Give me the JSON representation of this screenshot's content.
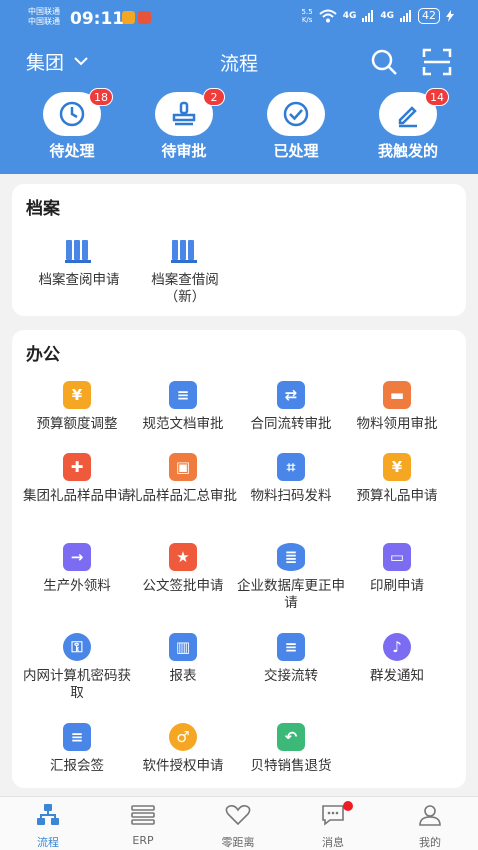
{
  "status": {
    "carrier1": "中国联通",
    "carrier2": "中国联通",
    "time": "09:11",
    "netspeed_top": "5.5",
    "netspeed_bottom": "K/s",
    "sig1": "4G",
    "sig2": "4G",
    "battery": "42"
  },
  "nav": {
    "group": "集团",
    "title": "流程"
  },
  "quick": [
    {
      "label": "待处理",
      "badge": "18"
    },
    {
      "label": "待审批",
      "badge": "2"
    },
    {
      "label": "已处理",
      "badge": ""
    },
    {
      "label": "我触发的",
      "badge": "14"
    }
  ],
  "archive": {
    "title": "档案",
    "items": [
      {
        "label": "档案查阅申请",
        "icon": "books-icon"
      },
      {
        "label": "档案查借阅（新）",
        "icon": "books-icon"
      }
    ]
  },
  "office": {
    "title": "办公",
    "items": [
      {
        "label": "预算额度调整",
        "icon": "budget-icon",
        "color": "#f5a623"
      },
      {
        "label": "规范文档审批",
        "icon": "document-icon",
        "color": "#4a86e8"
      },
      {
        "label": "合同流转审批",
        "icon": "contract-icon",
        "color": "#4a86e8"
      },
      {
        "label": "物料领用审批",
        "icon": "box-icon",
        "color": "#f07b3f"
      },
      {
        "label": "集团礼品样品申请",
        "icon": "gift-card-icon",
        "color": "#ee5a3b"
      },
      {
        "label": "礼品样品汇总审批",
        "icon": "gift-summary-icon",
        "color": "#f07b3f"
      },
      {
        "label": "物料扫码发料",
        "icon": "scan-icon",
        "color": "#4a86e8"
      },
      {
        "label": "预算礼品申请",
        "icon": "gift-icon",
        "color": "#f5a623"
      },
      {
        "label": "生产外领料",
        "icon": "inbox-icon",
        "color": "#7b6cf2"
      },
      {
        "label": "公文签批申请",
        "icon": "stamp-doc-icon",
        "color": "#ee5a3b"
      },
      {
        "label": "企业数据库更正申请",
        "icon": "database-icon",
        "color": "#4a86e8"
      },
      {
        "label": "印刷申请",
        "icon": "printer-icon",
        "color": "#7b6cf2"
      },
      {
        "label": "内网计算机密码获取",
        "icon": "key-icon",
        "color": "#4a86e8"
      },
      {
        "label": "报表",
        "icon": "report-icon",
        "color": "#4a86e8"
      },
      {
        "label": "交接流转",
        "icon": "handover-icon",
        "color": "#4a86e8"
      },
      {
        "label": "群发通知",
        "icon": "bell-icon",
        "color": "#7b6cf2"
      },
      {
        "label": "汇报会签",
        "icon": "report-sign-icon",
        "color": "#4a86e8"
      },
      {
        "label": "软件授权申请",
        "icon": "shield-icon",
        "color": "#f5a623"
      },
      {
        "label": "贝特销售退货",
        "icon": "return-icon",
        "color": "#3cb878"
      }
    ]
  },
  "tabs": [
    {
      "label": "流程",
      "icon": "flow-icon",
      "active": true,
      "dot": false
    },
    {
      "label": "ERP",
      "icon": "stack-icon",
      "active": false,
      "dot": false
    },
    {
      "label": "零距离",
      "icon": "heart-icon",
      "active": false,
      "dot": false
    },
    {
      "label": "消息",
      "icon": "chat-icon",
      "active": false,
      "dot": true
    },
    {
      "label": "我的",
      "icon": "user-icon",
      "active": false,
      "dot": false
    }
  ]
}
